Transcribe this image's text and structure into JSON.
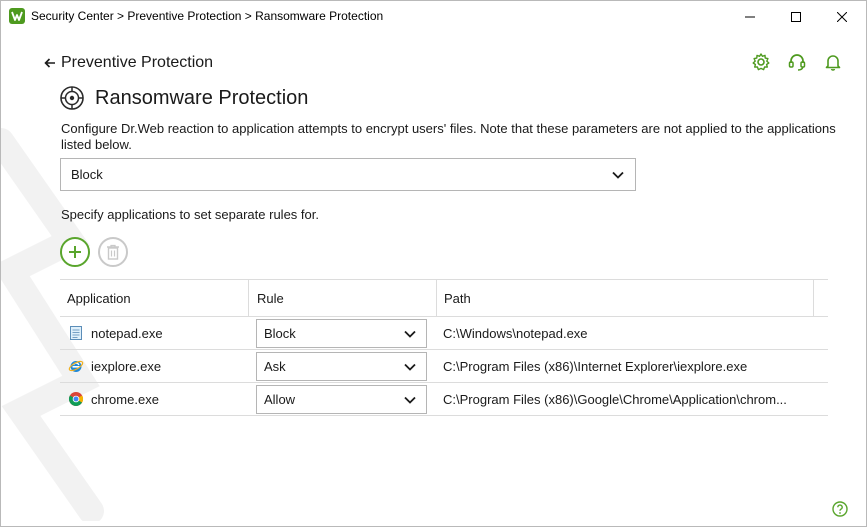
{
  "window": {
    "title": "Security Center > Preventive Protection > Ransomware Protection"
  },
  "header": {
    "back_label": "Preventive Protection",
    "page_title": "Ransomware Protection",
    "icons": [
      "gear-icon",
      "support-headset-icon",
      "bell-icon"
    ]
  },
  "content": {
    "description": "Configure Dr.Web reaction to application attempts to encrypt users' files. Note that these parameters are not applied to the applications listed below.",
    "reaction_value": "Block",
    "apps_hint": "Specify applications to set separate rules for."
  },
  "table": {
    "columns": [
      "Application",
      "Rule",
      "Path"
    ],
    "rows": [
      {
        "application": "notepad.exe",
        "rule": "Block",
        "path": "C:\\Windows\\notepad.exe",
        "icon": "notepad-icon"
      },
      {
        "application": "iexplore.exe",
        "rule": "Ask",
        "path": "C:\\Program Files (x86)\\Internet Explorer\\iexplore.exe",
        "icon": "internet-explorer-icon"
      },
      {
        "application": "chrome.exe",
        "rule": "Allow",
        "path": "C:\\Program Files (x86)\\Google\\Chrome\\Application\\chrom...",
        "icon": "chrome-icon"
      }
    ]
  },
  "colors": {
    "accent_green": "#59a52c",
    "border": "#b5b5b5",
    "disabled": "#c9c9c9"
  }
}
